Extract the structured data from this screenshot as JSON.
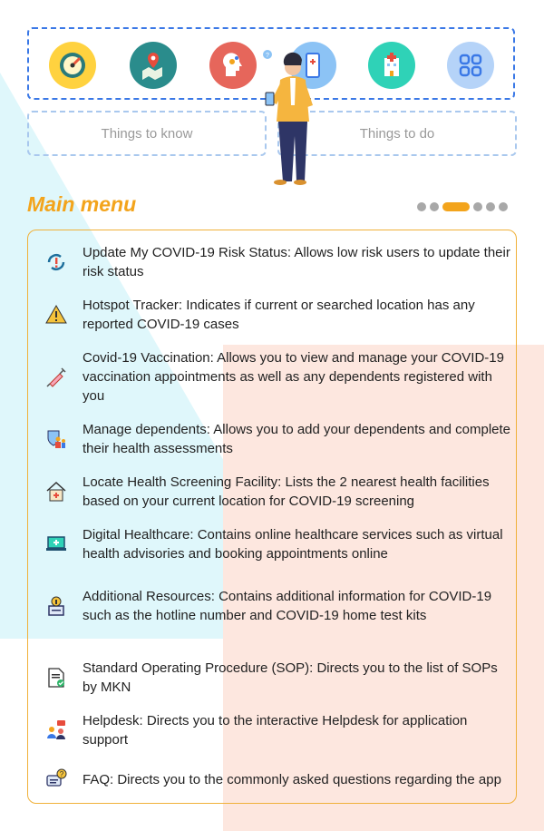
{
  "quick_icons": [
    {
      "name": "gauge-icon",
      "bg": "#ffd23f"
    },
    {
      "name": "map-pin-icon",
      "bg": "#2a8c8c"
    },
    {
      "name": "head-gears-icon",
      "bg": "#e6665b"
    },
    {
      "name": "phone-health-icon",
      "bg": "#8cc3f5"
    },
    {
      "name": "hospital-icon",
      "bg": "#2fd2b7"
    },
    {
      "name": "grid-apps-icon",
      "bg": "#b5d3f8"
    }
  ],
  "nav": {
    "things_to_know": "Things to know",
    "things_to_do": "Things to do"
  },
  "main_menu": {
    "title": "Main menu",
    "carousel": {
      "total": 6,
      "active_index": 2
    },
    "items": [
      {
        "icon": "refresh-alert-icon",
        "text": "Update My COVID-19 Risk Status: Allows low risk users to update their risk status"
      },
      {
        "icon": "warning-icon",
        "text": "Hotspot Tracker: Indicates if current or searched location has any reported COVID-19 cases"
      },
      {
        "icon": "syringe-icon",
        "text": "Covid-19 Vaccination: Allows you to view and manage your COVID-19 vaccination appointments as well as any dependents registered with you"
      },
      {
        "icon": "family-shield-icon",
        "text": "Manage dependents: Allows you to add your dependents and complete their health assessments"
      },
      {
        "icon": "house-health-icon",
        "text": "Locate Health Screening Facility: Lists the 2 nearest health facilities based on your current location for COVID-19 screening"
      },
      {
        "icon": "laptop-health-icon",
        "text": "Digital Healthcare: Contains online healthcare services such as virtual health advisories and booking appointments online"
      },
      {
        "icon": "info-resource-icon",
        "text": "Additional Resources: Contains additional information for COVID-19 such as the hotline number and COVID-19 home test kits"
      },
      {
        "icon": "document-check-icon",
        "text": "Standard Operating Procedure (SOP): Directs you to the list of SOPs by MKN"
      },
      {
        "icon": "helpdesk-icon",
        "text": "Helpdesk: Directs you to the interactive Helpdesk for application support"
      },
      {
        "icon": "faq-chat-icon",
        "text": "FAQ: Directs you to the commonly asked questions regarding the app"
      }
    ]
  },
  "colors": {
    "accent": "#f3a41c",
    "strip_border": "#3a78e6",
    "nav_border": "#a9c8ee"
  }
}
